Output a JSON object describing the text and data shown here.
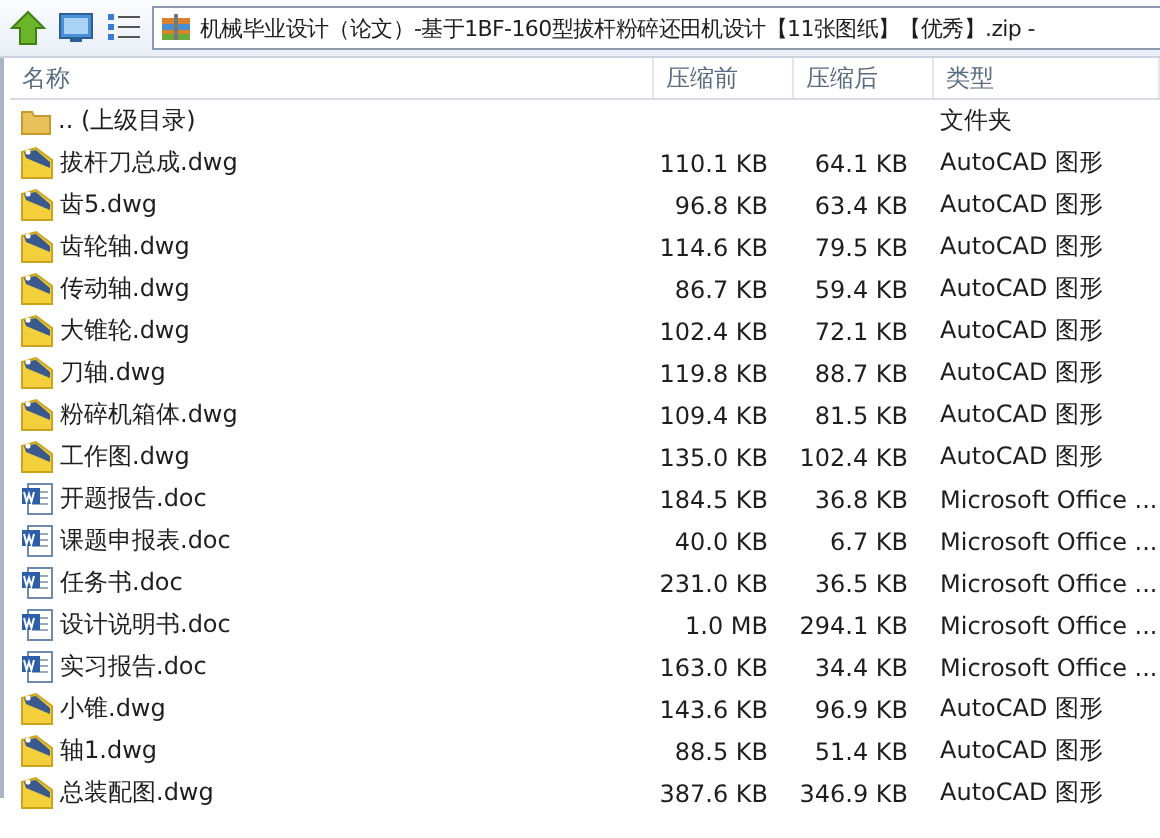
{
  "address_bar": {
    "path": "机械毕业设计（论文）-基于1BF-160型拔杆粉碎还田机设计【11张图纸】【优秀】.zip -"
  },
  "table": {
    "columns": [
      "名称",
      "压缩前",
      "压缩后",
      "类型"
    ],
    "rows": [
      {
        "kind": "folder",
        "name": ".. (上级目录)",
        "type": "文件夹"
      },
      {
        "kind": "dwg",
        "name": "拔杆刀总成.dwg",
        "size": "110.1 KB",
        "packed": "64.1 KB",
        "type": "AutoCAD 图形"
      },
      {
        "kind": "dwg",
        "name": "齿5.dwg",
        "size": "96.8 KB",
        "packed": "63.4 KB",
        "type": "AutoCAD 图形"
      },
      {
        "kind": "dwg",
        "name": "齿轮轴.dwg",
        "size": "114.6 KB",
        "packed": "79.5 KB",
        "type": "AutoCAD 图形"
      },
      {
        "kind": "dwg",
        "name": "传动轴.dwg",
        "size": "86.7 KB",
        "packed": "59.4 KB",
        "type": "AutoCAD 图形"
      },
      {
        "kind": "dwg",
        "name": "大锥轮.dwg",
        "size": "102.4 KB",
        "packed": "72.1 KB",
        "type": "AutoCAD 图形"
      },
      {
        "kind": "dwg",
        "name": "刀轴.dwg",
        "size": "119.8 KB",
        "packed": "88.7 KB",
        "type": "AutoCAD 图形"
      },
      {
        "kind": "dwg",
        "name": "粉碎机箱体.dwg",
        "size": "109.4 KB",
        "packed": "81.5 KB",
        "type": "AutoCAD 图形"
      },
      {
        "kind": "dwg",
        "name": "工作图.dwg",
        "size": "135.0 KB",
        "packed": "102.4 KB",
        "type": "AutoCAD 图形"
      },
      {
        "kind": "doc",
        "name": "开题报告.doc",
        "size": "184.5 KB",
        "packed": "36.8 KB",
        "type": "Microsoft Office ..."
      },
      {
        "kind": "doc",
        "name": "课题申报表.doc",
        "size": "40.0 KB",
        "packed": "6.7 KB",
        "type": "Microsoft Office ..."
      },
      {
        "kind": "doc",
        "name": "任务书.doc",
        "size": "231.0 KB",
        "packed": "36.5 KB",
        "type": "Microsoft Office ..."
      },
      {
        "kind": "doc",
        "name": "设计说明书.doc",
        "size": "1.0 MB",
        "packed": "294.1 KB",
        "type": "Microsoft Office ..."
      },
      {
        "kind": "doc",
        "name": "实习报告.doc",
        "size": "163.0 KB",
        "packed": "34.4 KB",
        "type": "Microsoft Office ..."
      },
      {
        "kind": "dwg",
        "name": "小锥.dwg",
        "size": "143.6 KB",
        "packed": "96.9 KB",
        "type": "AutoCAD 图形"
      },
      {
        "kind": "dwg",
        "name": "轴1.dwg",
        "size": "88.5 KB",
        "packed": "51.4 KB",
        "type": "AutoCAD 图形"
      },
      {
        "kind": "dwg",
        "name": "总装配图.dwg",
        "size": "387.6 KB",
        "packed": "346.9 KB",
        "type": "AutoCAD 图形"
      }
    ]
  }
}
